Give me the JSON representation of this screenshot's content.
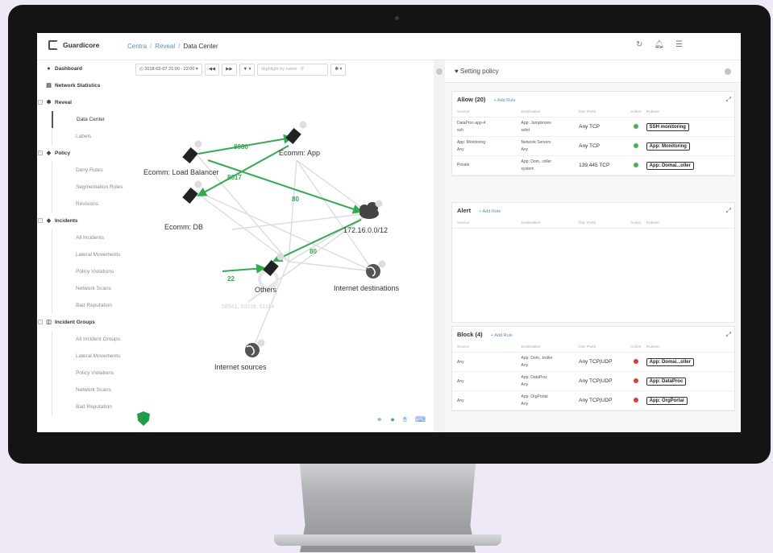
{
  "app": {
    "brand": "Guardicore"
  },
  "breadcrumb": {
    "root": "Centra",
    "mid": "Reveal",
    "current": "Data Center"
  },
  "topbar_icons": [
    "refresh-icon",
    "bell-icon",
    "settings-sliders-icon"
  ],
  "sidebar": {
    "groups": [
      {
        "label": "Dashboard",
        "icon": "dashboard-icon",
        "items": []
      },
      {
        "label": "Network Statistics",
        "icon": "network-stats-icon",
        "items": []
      },
      {
        "label": "Reveal",
        "icon": "reveal-icon",
        "items": [
          "Data Center",
          "Labels"
        ],
        "active": "Data Center"
      },
      {
        "label": "Policy",
        "icon": "shield-icon",
        "items": [
          "Deny Rules",
          "Segmentation Rules",
          "Revisions"
        ]
      },
      {
        "label": "Incidents",
        "icon": "diamond-icon",
        "items": [
          "All Incidents",
          "Lateral Movements",
          "Policy Violations",
          "Network Scans",
          "Bad Reputation"
        ]
      },
      {
        "label": "Incident Groups",
        "icon": "incident-groups-icon",
        "items": [
          "All Incident Groups",
          "Lateral Movements",
          "Policy Violations",
          "Network Scans",
          "Bad Reputation"
        ]
      }
    ]
  },
  "toolbar": {
    "time_range": "2018-02-07 21:00 - 22:00",
    "search_placeholder": "Highlight by name"
  },
  "graph": {
    "nodes": {
      "app": "Ecomm: App",
      "lb": "Ecomm: Load Balancer",
      "db": "Ecomm: DB",
      "cloud": "172.16.0.0/12",
      "others": "Others",
      "inet_dst": "Internet destinations",
      "inet_src": "Internet sources"
    },
    "edge_labels": {
      "e1": "8080",
      "e2": "8017",
      "e3": "80",
      "e4": "22",
      "e5": "80"
    },
    "faded_ports": "58941, 59316, 61114",
    "colors": {
      "allowed": "#2fae4e",
      "node": "#222222",
      "faded": "#d7d7d7"
    }
  },
  "policy_panel": {
    "title": "Setting policy",
    "add_rule": "+ Add Rule",
    "columns": [
      "Source",
      "Destination",
      "Dst. Ports",
      "Action",
      "Ruleset"
    ],
    "allow": {
      "title": "Allow (20)",
      "rows": [
        {
          "src1": "DataProc-app-4",
          "src2": "ssh",
          "dst1": "App: Jumpboxes",
          "dst2": "sshd",
          "ports": "Any TCP",
          "ruleset": "SSH monitoring"
        },
        {
          "src1": "App: Monitoring",
          "src2": "Any",
          "dst1": "Network Servers",
          "dst2": "Any",
          "ports": "Any TCP",
          "ruleset": "App: Monitoring"
        },
        {
          "src1": "Private",
          "src2": "",
          "dst1": "App: Dom...roller",
          "dst2": "system",
          "ports": "139,445 TCP",
          "ruleset": "App: Domai...oller"
        }
      ]
    },
    "alert": {
      "title": "Alert",
      "columns": [
        "Source",
        "Destination",
        "Dst. Ports",
        "Action",
        "Ruleset"
      ]
    },
    "block": {
      "title": "Block (4)",
      "rows": [
        {
          "src1": "Any",
          "dst1": "App: Dom...troller",
          "dst2": "Any",
          "ports": "Any TCP|UDP",
          "ruleset": "App: Domai...oller"
        },
        {
          "src1": "Any",
          "dst1": "App: DataProc",
          "dst2": "Any",
          "ports": "Any TCP|UDP",
          "ruleset": "App: DataProc"
        },
        {
          "src1": "Any",
          "dst1": "App: OrgPortal",
          "dst2": "Any",
          "ports": "Any TCP|UDP",
          "ruleset": "App: OrgPortal"
        }
      ]
    },
    "colors": {
      "allow": "#4caf50",
      "block": "#e53935"
    }
  }
}
